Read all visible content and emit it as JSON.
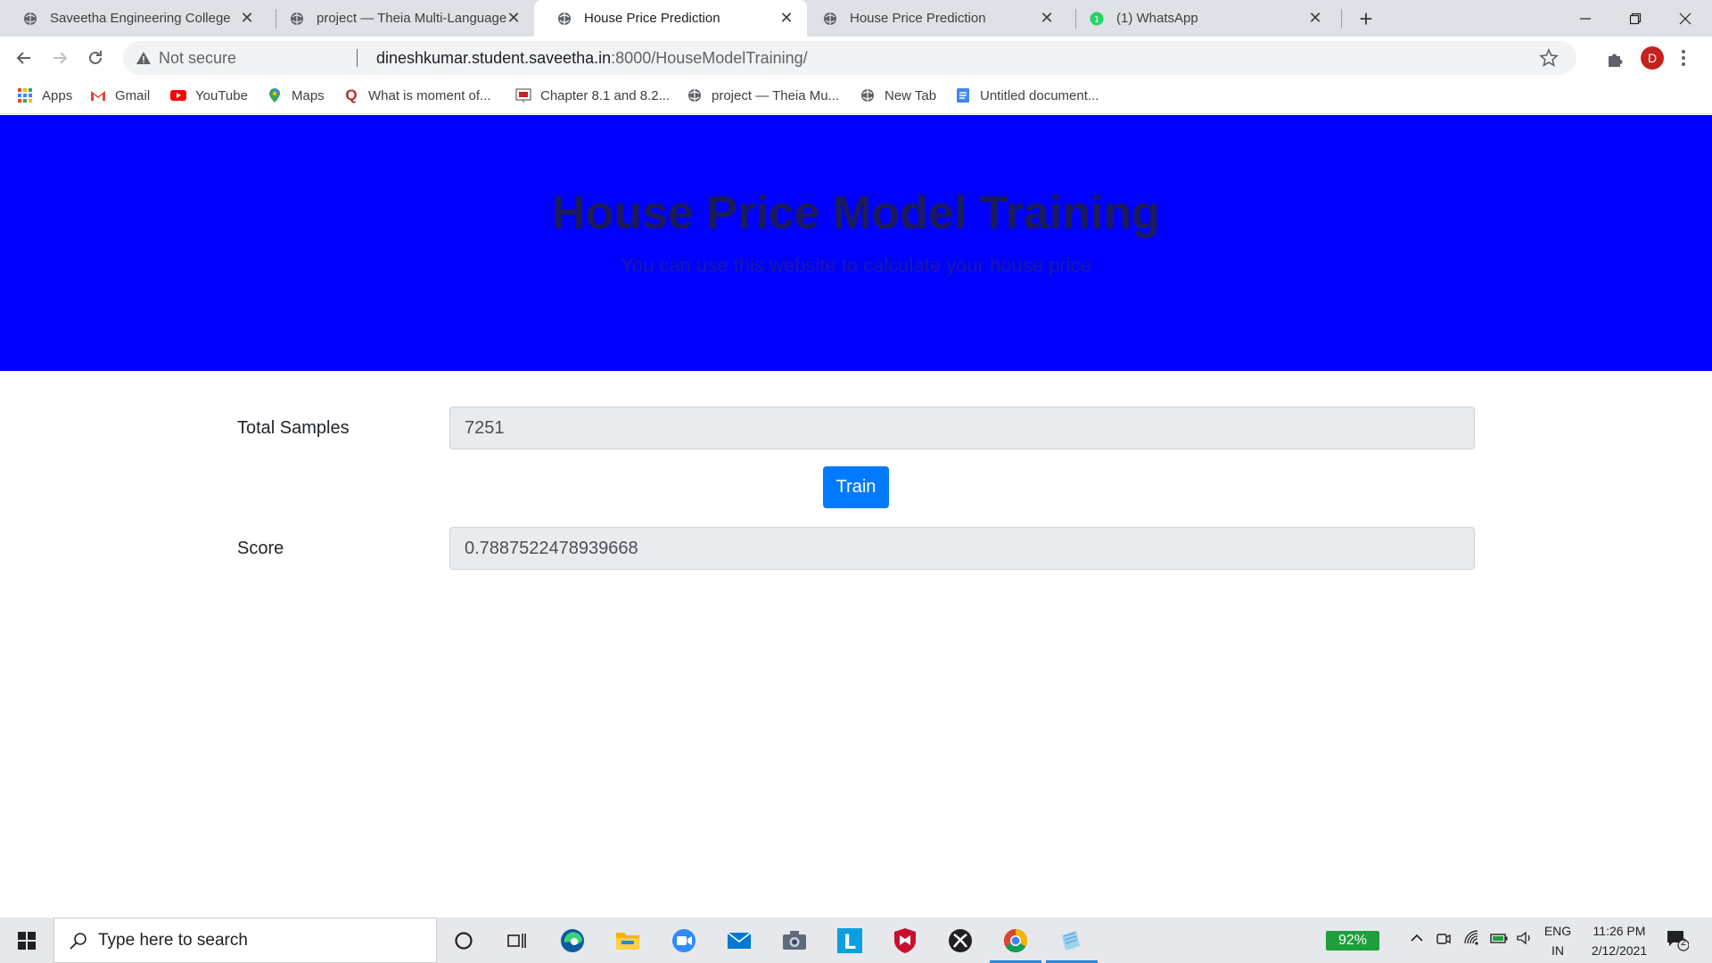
{
  "browser": {
    "tabs": [
      {
        "title": "Saveetha Engineering College",
        "active": false
      },
      {
        "title": "project — Theia Multi-Language",
        "active": false
      },
      {
        "title": "House Price Prediction",
        "active": true
      },
      {
        "title": "House Price Prediction",
        "active": false
      },
      {
        "title": "(1) WhatsApp",
        "active": false
      }
    ],
    "address": {
      "security_text": "Not secure",
      "host": "dineshkumar.student.saveetha.in",
      "path": ":8000/HouseModelTraining/"
    },
    "profile_initial": "D",
    "bookmarks": [
      {
        "label": "Apps",
        "icon": "apps-grid-icon"
      },
      {
        "label": "Gmail",
        "icon": "gmail-icon"
      },
      {
        "label": "YouTube",
        "icon": "youtube-icon"
      },
      {
        "label": "Maps",
        "icon": "maps-icon"
      },
      {
        "label": "What is moment of...",
        "icon": "quora-icon"
      },
      {
        "label": "Chapter 8.1 and 8.2...",
        "icon": "slides-icon"
      },
      {
        "label": "project — Theia Mu...",
        "icon": "globe-icon"
      },
      {
        "label": "New Tab",
        "icon": "globe-icon"
      },
      {
        "label": "Untitled document...",
        "icon": "docs-icon"
      }
    ]
  },
  "page": {
    "hero": {
      "title": "House Price Model Training",
      "subtitle": "You can use this website to calculate your house price",
      "background": "#0000ff"
    },
    "form": {
      "total_samples_label": "Total Samples",
      "total_samples_value": "7251",
      "train_button": "Train",
      "score_label": "Score",
      "score_value": "0.7887522478939668",
      "accent": "#007bff"
    }
  },
  "taskbar": {
    "search_placeholder": "Type here to search",
    "battery": "92%",
    "language_line1": "ENG",
    "language_line2": "IN",
    "time": "11:26 PM",
    "date": "2/12/2021",
    "notification_count": "2"
  }
}
